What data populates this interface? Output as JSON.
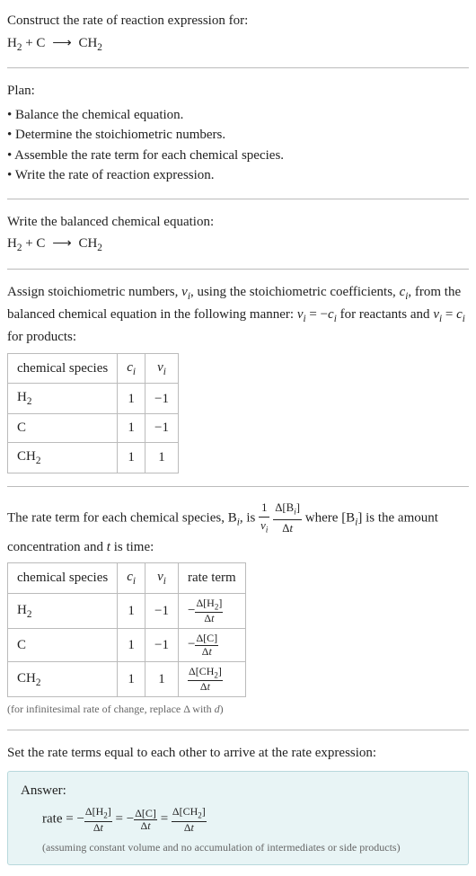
{
  "intro": {
    "prompt": "Construct the rate of reaction expression for:",
    "equation_html": "H<span class='sub'>2</span> + C <span class='arrow'>⟶</span> CH<span class='sub'>2</span>"
  },
  "plan": {
    "title": "Plan:",
    "items": [
      "• Balance the chemical equation.",
      "• Determine the stoichiometric numbers.",
      "• Assemble the rate term for each chemical species.",
      "• Write the rate of reaction expression."
    ]
  },
  "balanced": {
    "title": "Write the balanced chemical equation:",
    "equation_html": "H<span class='sub'>2</span> + C <span class='arrow'>⟶</span> CH<span class='sub'>2</span>"
  },
  "stoich": {
    "intro_html": "Assign stoichiometric numbers, <span class='italic'>ν<span class='sub'>i</span></span>, using the stoichiometric coefficients, <span class='italic'>c<span class='sub'>i</span></span>, from the balanced chemical equation in the following manner: <span class='italic'>ν<span class='sub'>i</span></span> = −<span class='italic'>c<span class='sub'>i</span></span> for reactants and <span class='italic'>ν<span class='sub'>i</span></span> = <span class='italic'>c<span class='sub'>i</span></span> for products:",
    "headers": {
      "species": "chemical species",
      "ci_html": "<span class='italic'>c<span class='sub'>i</span></span>",
      "vi_html": "<span class='italic'>ν<span class='sub'>i</span></span>"
    },
    "rows": [
      {
        "species_html": "H<span class='sub'>2</span>",
        "ci": "1",
        "vi": "−1"
      },
      {
        "species_html": "C",
        "ci": "1",
        "vi": "−1"
      },
      {
        "species_html": "CH<span class='sub'>2</span>",
        "ci": "1",
        "vi": "1"
      }
    ]
  },
  "rateterm": {
    "intro_html": "The rate term for each chemical species, B<span class='sub italic'>i</span>, is <span class='frac'><span class='num'>1</span><span class='den italic'>ν<span class='sub'>i</span></span></span> <span class='frac'><span class='num'>Δ[B<span class='sub italic'>i</span>]</span><span class='den'>Δ<span class='italic'>t</span></span></span> where [B<span class='sub italic'>i</span>] is the amount concentration and <span class='italic'>t</span> is time:",
    "headers": {
      "species": "chemical species",
      "ci_html": "<span class='italic'>c<span class='sub'>i</span></span>",
      "vi_html": "<span class='italic'>ν<span class='sub'>i</span></span>",
      "rate": "rate term"
    },
    "rows": [
      {
        "species_html": "H<span class='sub'>2</span>",
        "ci": "1",
        "vi": "−1",
        "rate_html": "−<span class='delta-frac'><span class='num'>Δ[H<span class='sub'>2</span>]</span><span class='den'>Δ<span class='italic'>t</span></span></span>"
      },
      {
        "species_html": "C",
        "ci": "1",
        "vi": "−1",
        "rate_html": "−<span class='delta-frac'><span class='num'>Δ[C]</span><span class='den'>Δ<span class='italic'>t</span></span></span>"
      },
      {
        "species_html": "CH<span class='sub'>2</span>",
        "ci": "1",
        "vi": "1",
        "rate_html": "<span class='delta-frac'><span class='num'>Δ[CH<span class='sub'>2</span>]</span><span class='den'>Δ<span class='italic'>t</span></span></span>"
      }
    ],
    "note_html": "(for infinitesimal rate of change, replace Δ with <span class='italic'>d</span>)"
  },
  "final": {
    "title": "Set the rate terms equal to each other to arrive at the rate expression:"
  },
  "answer": {
    "label": "Answer:",
    "rate_html": "rate = −<span class='delta-frac'><span class='num'>Δ[H<span class='sub'>2</span>]</span><span class='den'>Δ<span class='italic'>t</span></span></span> = −<span class='delta-frac'><span class='num'>Δ[C]</span><span class='den'>Δ<span class='italic'>t</span></span></span> = <span class='delta-frac'><span class='num'>Δ[CH<span class='sub'>2</span>]</span><span class='den'>Δ<span class='italic'>t</span></span></span>",
    "note": "(assuming constant volume and no accumulation of intermediates or side products)"
  }
}
